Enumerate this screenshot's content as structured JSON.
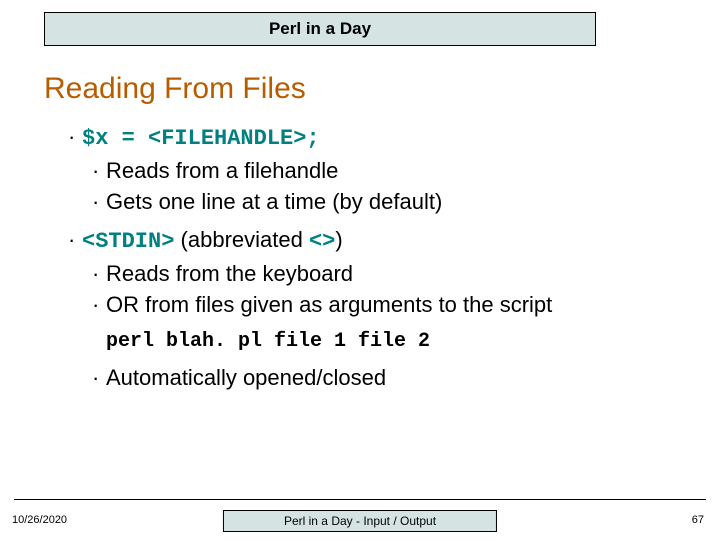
{
  "header": {
    "title": "Perl in a Day"
  },
  "slide": {
    "title": "Reading From Files"
  },
  "body": {
    "item1_code": "$x = <FILEHANDLE>;",
    "item1_sub1": "Reads from a filehandle",
    "item1_sub2": "Gets one line at a time (by default)",
    "item2_code": "<STDIN>",
    "item2_text_a": " (abbreviated ",
    "item2_code2": "<>",
    "item2_text_b": ")",
    "item2_sub1": "Reads from the keyboard",
    "item2_sub2": "OR from files given as arguments to the script",
    "item2_cmd": "perl blah. pl file 1 file 2",
    "item2_sub3": "Automatically opened/closed"
  },
  "footer": {
    "date": "10/26/2020",
    "center": "Perl in a Day - Input / Output",
    "page": "67"
  }
}
